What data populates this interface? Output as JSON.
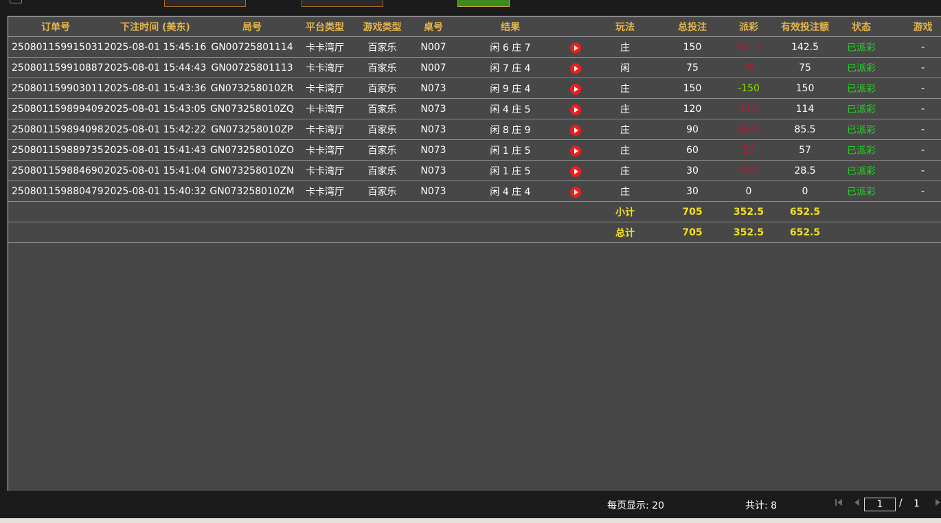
{
  "table": {
    "headers": [
      "订单号",
      "下注时间 (美东)",
      "局号",
      "平台类型",
      "游戏类型",
      "桌号",
      "结果",
      "",
      "玩法",
      "总投注",
      "派彩",
      "有效投注额",
      "状态",
      "游戏"
    ],
    "rows": [
      {
        "order": "250801159915031",
        "time": "2025-08-01 15:45:16",
        "round": "GN00725801114",
        "platform": "卡卡湾厅",
        "game": "百家乐",
        "table": "N007",
        "result": "闲 6 庄 7",
        "play": "庄",
        "bet": "150",
        "payout": "142.5",
        "payout_color": "red",
        "valid": "142.5",
        "status": "已派彩",
        "extra": "-"
      },
      {
        "order": "250801159910887",
        "time": "2025-08-01 15:44:43",
        "round": "GN00725801113",
        "platform": "卡卡湾厅",
        "game": "百家乐",
        "table": "N007",
        "result": "闲 7 庄 4",
        "play": "闲",
        "bet": "75",
        "payout": "75",
        "payout_color": "red",
        "valid": "75",
        "status": "已派彩",
        "extra": "-"
      },
      {
        "order": "250801159903011",
        "time": "2025-08-01 15:43:36",
        "round": "GN073258010ZR",
        "platform": "卡卡湾厅",
        "game": "百家乐",
        "table": "N073",
        "result": "闲 9 庄 4",
        "play": "庄",
        "bet": "150",
        "payout": "-150",
        "payout_color": "green",
        "valid": "150",
        "status": "已派彩",
        "extra": "-"
      },
      {
        "order": "250801159899409",
        "time": "2025-08-01 15:43:05",
        "round": "GN073258010ZQ",
        "platform": "卡卡湾厅",
        "game": "百家乐",
        "table": "N073",
        "result": "闲 4 庄 5",
        "play": "庄",
        "bet": "120",
        "payout": "114",
        "payout_color": "red",
        "valid": "114",
        "status": "已派彩",
        "extra": "-"
      },
      {
        "order": "250801159894098",
        "time": "2025-08-01 15:42:22",
        "round": "GN073258010ZP",
        "platform": "卡卡湾厅",
        "game": "百家乐",
        "table": "N073",
        "result": "闲 8 庄 9",
        "play": "庄",
        "bet": "90",
        "payout": "85.5",
        "payout_color": "red",
        "valid": "85.5",
        "status": "已派彩",
        "extra": "-"
      },
      {
        "order": "250801159889735",
        "time": "2025-08-01 15:41:43",
        "round": "GN073258010ZO",
        "platform": "卡卡湾厅",
        "game": "百家乐",
        "table": "N073",
        "result": "闲 1 庄 5",
        "play": "庄",
        "bet": "60",
        "payout": "57",
        "payout_color": "red",
        "valid": "57",
        "status": "已派彩",
        "extra": "-"
      },
      {
        "order": "250801159884690",
        "time": "2025-08-01 15:41:04",
        "round": "GN073258010ZN",
        "platform": "卡卡湾厅",
        "game": "百家乐",
        "table": "N073",
        "result": "闲 1 庄 5",
        "play": "庄",
        "bet": "30",
        "payout": "28.5",
        "payout_color": "red",
        "valid": "28.5",
        "status": "已派彩",
        "extra": "-"
      },
      {
        "order": "250801159880479",
        "time": "2025-08-01 15:40:32",
        "round": "GN073258010ZM",
        "platform": "卡卡湾厅",
        "game": "百家乐",
        "table": "N073",
        "result": "闲 4 庄 4",
        "play": "庄",
        "bet": "30",
        "payout": "0",
        "payout_color": "white",
        "valid": "0",
        "status": "已派彩",
        "extra": "-"
      }
    ],
    "subtotal": {
      "label": "小计",
      "bet": "705",
      "payout": "352.5",
      "valid": "652.5"
    },
    "total": {
      "label": "总计",
      "bet": "705",
      "payout": "352.5",
      "valid": "652.5"
    }
  },
  "pagination": {
    "per_page": "每页显示: 20",
    "total_count": "共计: 8",
    "current_page": "1",
    "separator": "/",
    "total_pages": "1"
  },
  "colors": {
    "header_text": "#e3b54e",
    "payout_red": "#c2142f",
    "payout_green": "#88e000",
    "status_green": "#22d322",
    "sum_yellow": "#f2e01b"
  }
}
